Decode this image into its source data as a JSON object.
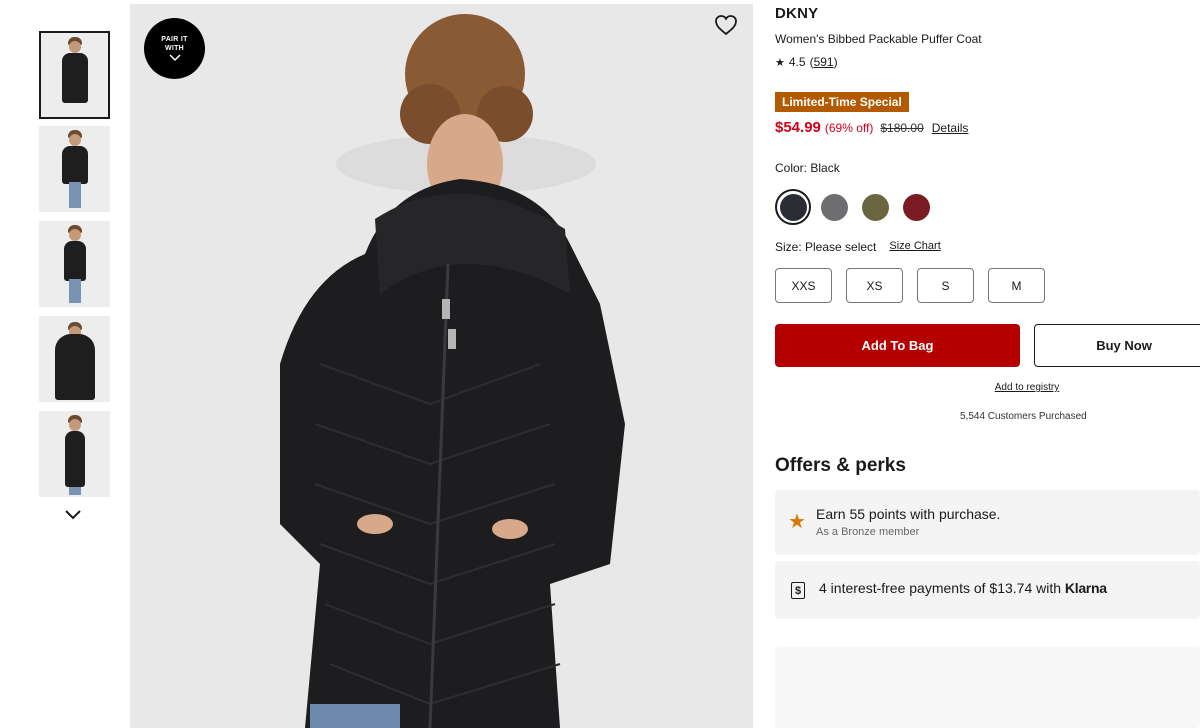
{
  "gallery": {
    "thumbnails": [
      "thumb-front",
      "thumb-full",
      "thumb-side",
      "thumb-back-hood",
      "thumb-profile"
    ],
    "selected_index": 0,
    "more_icon": "chevron-down-icon"
  },
  "main_image": {
    "pair_button_label": "PAIR IT WITH",
    "wishlist_icon": "heart-icon"
  },
  "product": {
    "brand": "DKNY",
    "name": "Women's Bibbed Packable Puffer Coat",
    "rating_value": "4.5",
    "rating_count": "591",
    "promo_badge": "Limited-Time Special",
    "sale_price": "$54.99",
    "discount": "(69% off)",
    "original_price": "$180.00",
    "details_link": "Details",
    "color_label": "Color: Black",
    "colors": [
      {
        "name": "Black",
        "hex": "#2a2d33"
      },
      {
        "name": "Gray",
        "hex": "#6e6e70"
      },
      {
        "name": "Olive",
        "hex": "#6b6540"
      },
      {
        "name": "Burgundy",
        "hex": "#7a1c22"
      }
    ],
    "selected_color_index": 0,
    "size_label": "Size: Please select",
    "size_chart_link": "Size Chart",
    "sizes": [
      "XXS",
      "XS",
      "S",
      "M"
    ]
  },
  "actions": {
    "add_to_bag": "Add To Bag",
    "buy_now": "Buy Now",
    "add_to_registry": "Add to registry",
    "customers_purchased": "5,544 Customers Purchased"
  },
  "offers": {
    "title": "Offers & perks",
    "points_main": "Earn 55 points with purchase.",
    "points_sub": "As a Bronze member",
    "klarna_text": "4 interest-free payments of $13.74 with",
    "klarna_brand": "Klarna"
  },
  "colors": {
    "accent_red": "#b40000",
    "price_red": "#d0021b",
    "promo_orange": "#b35a00"
  }
}
